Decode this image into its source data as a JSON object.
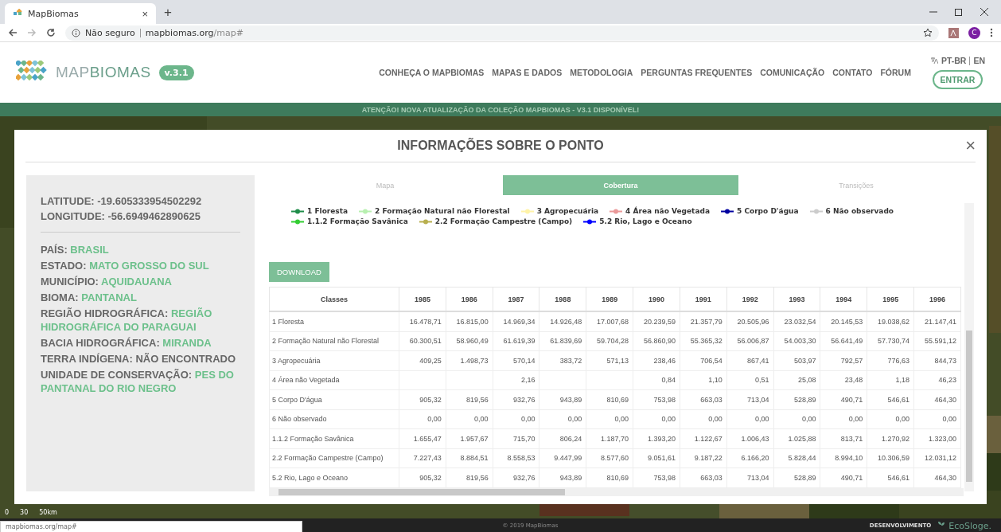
{
  "browser": {
    "tab_title": "MapBiomas",
    "tab_close": "×",
    "new_tab": "+",
    "security": "Não seguro",
    "url_domain": "mapbiomas.org",
    "url_path": "/map#",
    "avatar": "C"
  },
  "site": {
    "logo_prefix": "MAP",
    "logo_suffix": "BIOMAS",
    "version": "v.3.1",
    "nav": [
      "CONHEÇA O MAPBIOMAS",
      "MAPAS E DADOS",
      "METODOLOGIA",
      "PERGUNTAS FREQUENTES",
      "COMUNICAÇÃO",
      "CONTATO",
      "FÓRUM"
    ],
    "languages": [
      "PT-BR",
      "EN"
    ],
    "login": "ENTRAR",
    "banner": "ATENÇÃO! NOVA ATUALIZAÇÃO DA COLEÇÃO MAPBIOMAS - V3.1 DISPONÍVEL!"
  },
  "modal": {
    "title": "INFORMAÇÕES SOBRE O PONTO",
    "close": "×",
    "coordinates": [
      {
        "label": "LATITUDE:",
        "value": "-19.605333954502292"
      },
      {
        "label": "LONGITUDE:",
        "value": "-56.6949462890625"
      }
    ],
    "details": [
      {
        "label": "PAÍS:",
        "value": "BRASIL",
        "highlighted": true
      },
      {
        "label": "ESTADO:",
        "value": "MATO GROSSO DO SUL",
        "highlighted": true
      },
      {
        "label": "MUNICÍPIO:",
        "value": "AQUIDAUANA",
        "highlighted": true
      },
      {
        "label": "BIOMA:",
        "value": "PANTANAL",
        "highlighted": true
      },
      {
        "label": "REGIÃO HIDROGRÁFICA:",
        "value": "REGIÃO HIDROGRÁFICA DO PARAGUAI",
        "highlighted": true
      },
      {
        "label": "BACIA HIDROGRÁFICA:",
        "value": "MIRANDA",
        "highlighted": true
      },
      {
        "label": "TERRA INDÍGENA:",
        "value": "NÃO ENCONTRADO",
        "highlighted": false
      },
      {
        "label": "UNIDADE DE CONSERVAÇÃO:",
        "value": "PES DO PANTANAL DO RIO NEGRO",
        "highlighted": true
      }
    ],
    "tabs": [
      {
        "label": "Mapa",
        "selected": false
      },
      {
        "label": "Cobertura",
        "selected": true
      },
      {
        "label": "Transições",
        "selected": false
      }
    ],
    "legend": [
      {
        "label": "1 Floresta",
        "color": "#1f8d49"
      },
      {
        "label": "2 Formação Natural não Florestal",
        "color": "#b8f0b0"
      },
      {
        "label": "3 Agropecuária",
        "color": "#fff3a8"
      },
      {
        "label": "4 Área não Vegetada",
        "color": "#ea9999"
      },
      {
        "label": "5 Corpo D'água",
        "color": "#0000a0"
      },
      {
        "label": "6 Não observado",
        "color": "#cccccc"
      },
      {
        "label": "1.1.2 Formação Savânica",
        "color": "#32cd32"
      },
      {
        "label": "2.2 Formação Campestre (Campo)",
        "color": "#b8af4f"
      },
      {
        "label": "5.2 Rio, Lago e Oceano",
        "color": "#0000ff"
      }
    ],
    "download": "DOWNLOAD",
    "table": {
      "columns": [
        "Classes",
        "1985",
        "1986",
        "1987",
        "1988",
        "1989",
        "1990",
        "1991",
        "1992",
        "1993",
        "1994",
        "1995",
        "1996"
      ],
      "rows": [
        [
          "1 Floresta",
          "16.478,71",
          "16.815,00",
          "14.969,34",
          "14.926,48",
          "17.007,68",
          "20.239,59",
          "21.357,79",
          "20.505,96",
          "23.032,54",
          "20.145,53",
          "19.038,62",
          "21.147,41"
        ],
        [
          "2 Formação Natural não Florestal",
          "60.300,51",
          "58.960,49",
          "61.619,39",
          "61.839,69",
          "59.704,28",
          "56.860,90",
          "55.365,32",
          "56.006,87",
          "54.003,30",
          "56.641,49",
          "57.730,74",
          "55.591,12"
        ],
        [
          "3 Agropecuária",
          "409,25",
          "1.498,73",
          "570,14",
          "383,72",
          "571,13",
          "238,46",
          "706,54",
          "867,41",
          "503,97",
          "792,57",
          "776,63",
          "844,73"
        ],
        [
          "4 Área não Vegetada",
          null,
          null,
          "2,16",
          null,
          null,
          "0,84",
          "1,10",
          "0,51",
          "25,08",
          "23,48",
          "1,18",
          "46,23"
        ],
        [
          "5 Corpo D'água",
          "905,32",
          "819,56",
          "932,76",
          "943,89",
          "810,69",
          "753,98",
          "663,03",
          "713,04",
          "528,89",
          "490,71",
          "546,61",
          "464,30"
        ],
        [
          "6 Não observado",
          "0,00",
          "0,00",
          "0,00",
          "0,00",
          "0,00",
          "0,00",
          "0,00",
          "0,00",
          "0,00",
          "0,00",
          "0,00",
          "0,00"
        ],
        [
          "1.1.2 Formação Savânica",
          "1.655,47",
          "1.957,67",
          "715,70",
          "806,24",
          "1.187,70",
          "1.393,20",
          "1.122,67",
          "1.006,43",
          "1.025,88",
          "813,71",
          "1.270,92",
          "1.323,00"
        ],
        [
          "2.2 Formação Campestre (Campo)",
          "7.227,43",
          "8.884,51",
          "8.558,53",
          "9.447,99",
          "8.577,60",
          "9.051,61",
          "9.187,22",
          "6.166,20",
          "5.828,44",
          "8.994,10",
          "10.306,59",
          "12.031,12"
        ],
        [
          "5.2 Rio, Lago e Oceano",
          "905,32",
          "819,56",
          "932,76",
          "943,89",
          "810,69",
          "753,98",
          "663,03",
          "713,04",
          "528,89",
          "490,71",
          "546,61",
          "464,30"
        ]
      ]
    }
  },
  "map": {
    "scale": [
      "0",
      "30",
      "50km"
    ]
  },
  "footer": {
    "status_url": "mapbiomas.org/map#",
    "copyright": "© 2019 MapBiomas",
    "credit": "DESENVOLVIMENTO",
    "developer": "EcoSloge."
  }
}
